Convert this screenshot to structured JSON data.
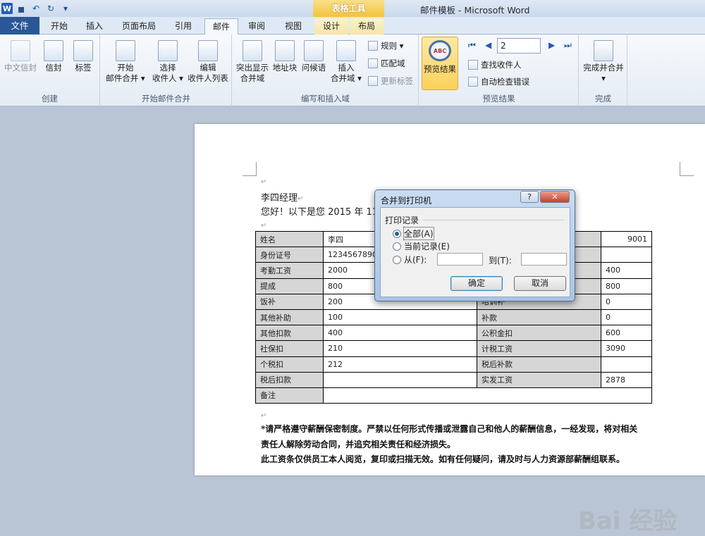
{
  "qat": {
    "undo": "↶",
    "redo": "↻",
    "more": "▾",
    "save": "▪",
    "logo": "W"
  },
  "context_tab_group": "表格工具",
  "window_title": "邮件模板  -  Microsoft Word",
  "tabs": [
    "文件",
    "开始",
    "插入",
    "页面布局",
    "引用",
    "邮件",
    "审阅",
    "视图",
    "设计",
    "布局"
  ],
  "ribbon": {
    "create": {
      "label": "创建",
      "chinese_envelope": "中文信封",
      "envelope": "信封",
      "labels": "标签"
    },
    "start_merge": {
      "label": "开始邮件合并",
      "start_line1": "开始",
      "start_line2": "邮件合并 ▾",
      "select_line1": "选择",
      "select_line2": "收件人 ▾",
      "edit_line1": "编辑",
      "edit_line2": "收件人列表"
    },
    "write_insert": {
      "label": "编写和插入域",
      "highlight_line1": "突出显示",
      "highlight_line2": "合并域",
      "address_block": "地址块",
      "greeting": "问候语",
      "insert_line1": "插入",
      "insert_line2": "合并域 ▾",
      "rules": "规则 ▾",
      "match_fields": "匹配域",
      "update_labels": "更新标签"
    },
    "preview": {
      "label": "预览结果",
      "preview_results": "预览结果",
      "preview_icon_text": "ABC",
      "record": "2",
      "find_recipient": "查找收件人",
      "auto_check": "自动检查错误"
    },
    "finish": {
      "label": "完成",
      "finish_merge": "完成并合并",
      "arrow": "▾"
    }
  },
  "document": {
    "greeting_name": "李四经理",
    "greeting_line": "您好！以下是您 2015 年 11",
    "table": [
      [
        {
          "t": "姓名",
          "lbl": true
        },
        {
          "t": "李四"
        },
        {
          "t": "",
          "lbl": true
        },
        {
          "t": "9001"
        }
      ],
      [
        {
          "t": "身份证号",
          "lbl": true
        },
        {
          "t": "12345678901"
        },
        {
          "t": "",
          "lbl": true
        },
        {
          "t": ""
        }
      ],
      [
        {
          "t": "考勤工资",
          "lbl": true
        },
        {
          "t": "2000"
        },
        {
          "t": "",
          "lbl": true
        },
        {
          "t": "400"
        }
      ],
      [
        {
          "t": "提成",
          "lbl": true
        },
        {
          "t": "800"
        },
        {
          "t": "",
          "lbl": true
        },
        {
          "t": "800"
        }
      ],
      [
        {
          "t": "饭补",
          "lbl": true
        },
        {
          "t": "200"
        },
        {
          "t": "培训补",
          "lbl": true
        },
        {
          "t": "0"
        }
      ],
      [
        {
          "t": "其他补助",
          "lbl": true
        },
        {
          "t": "100"
        },
        {
          "t": "补款",
          "lbl": true
        },
        {
          "t": "0"
        }
      ],
      [
        {
          "t": "其他扣款",
          "lbl": true
        },
        {
          "t": "400"
        },
        {
          "t": "公积金扣",
          "lbl": true
        },
        {
          "t": "600"
        }
      ],
      [
        {
          "t": "社保扣",
          "lbl": true
        },
        {
          "t": "210"
        },
        {
          "t": "计税工资",
          "lbl": true
        },
        {
          "t": "3090"
        }
      ],
      [
        {
          "t": "个税扣",
          "lbl": true
        },
        {
          "t": "212"
        },
        {
          "t": "税后补款",
          "lbl": true
        },
        {
          "t": ""
        }
      ],
      [
        {
          "t": "税后扣款",
          "lbl": true
        },
        {
          "t": ""
        },
        {
          "t": "实发工资",
          "lbl": true
        },
        {
          "t": "2878"
        }
      ],
      [
        {
          "t": "备注",
          "lbl": true
        },
        {
          "t": "",
          "span": 3
        }
      ]
    ],
    "note1": "*请严格遵守薪酬保密制度。严禁以任何形式传播或泄露自己和他人的薪酬信息，一经发现，将对相关",
    "note2": "责任人解除劳动合同，并追究相关责任和经济损失。",
    "note3": "此工资条仅供员工本人阅览，复印或扫描无效。如有任何疑问，请及时与人力资源部薪酬组联系。",
    "para_mark": "↵"
  },
  "dialog": {
    "title": "合并到打印机",
    "help": "?",
    "close": "✕",
    "group_label": "打印记录",
    "opt_all": "全部(A)",
    "opt_current": "当前记录(E)",
    "opt_from": "从(F):",
    "to_label": "到(T):",
    "from_value": "",
    "to_value": "",
    "ok": "确定",
    "cancel": "取消"
  },
  "watermark": "Bai 经验"
}
